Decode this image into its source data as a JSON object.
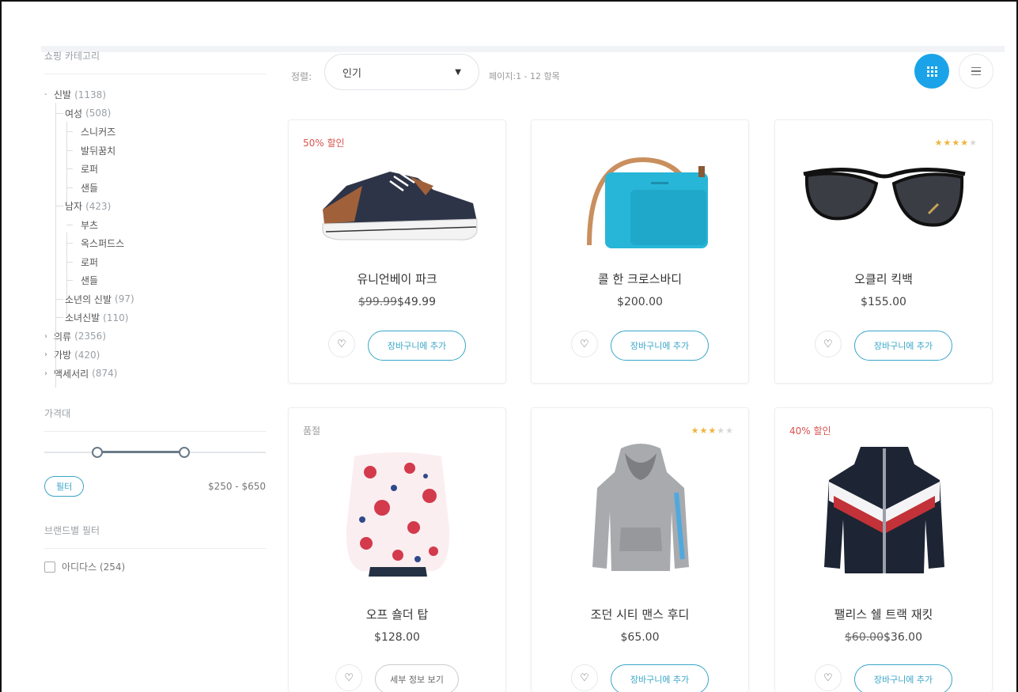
{
  "sidebar": {
    "categories_title": "쇼핑 카테고리",
    "tree": [
      {
        "label": "신발",
        "count": "(1138)",
        "caret": "-"
      },
      {
        "label": "여성",
        "count": "(508)"
      },
      {
        "label": "스니커즈"
      },
      {
        "label": "발뒤꿈치"
      },
      {
        "label": "로퍼"
      },
      {
        "label": "샌들"
      },
      {
        "label": "남자",
        "count": "(423)"
      },
      {
        "label": "부츠"
      },
      {
        "label": "옥스퍼드스"
      },
      {
        "label": "로퍼"
      },
      {
        "label": "샌들"
      },
      {
        "label": "소년의 신발",
        "count": "(97)"
      },
      {
        "label": "소녀신발",
        "count": "(110)"
      },
      {
        "label": "의류",
        "count": "(2356)",
        "caret": "›"
      },
      {
        "label": "가방",
        "count": "(420)",
        "caret": "›"
      },
      {
        "label": "액세서리",
        "count": "(874)",
        "caret": "›"
      }
    ],
    "price_title": "가격대",
    "filter_label": "필터",
    "price_range": "$250 - $650",
    "brand_title": "브랜드별 필터",
    "brand_first": "아디다스 (254)"
  },
  "toolbar": {
    "sort_label": "정렬:",
    "sort_value": "인기",
    "page_info": "페이지:1 - 12 항목"
  },
  "products": [
    {
      "badge": "50% 할인",
      "name": "유니언베이 파크",
      "old_price": "$99.99",
      "price": "$49.99",
      "button": "장바구니에 추가"
    },
    {
      "name": "콜 한 크로스바디",
      "price": "$200.00",
      "button": "장바구니에 추가"
    },
    {
      "rating": 4,
      "name": "오클리 킥백",
      "price": "$155.00",
      "button": "장바구니에 추가"
    },
    {
      "badge": "품절",
      "name": "오프 숄더 탑",
      "price": "$128.00",
      "button": "세부 정보 보기"
    },
    {
      "rating": 3,
      "name": "조던 시티 맨스 후디",
      "price": "$65.00",
      "button": "장바구니에 추가"
    },
    {
      "badge": "40% 할인",
      "name": "팰리스 쉘 트랙 재킷",
      "old_price": "$60.00",
      "price": "$36.00",
      "button": "장바구니에 추가"
    }
  ],
  "colors": {
    "accent": "#1aa3e8",
    "button_outline": "#3aa6c9",
    "sale": "#d9534f",
    "star": "#f0b43c"
  },
  "icons": {
    "grid_view": "grid-icon",
    "list_view": "list-icon",
    "wishlist": "heart-icon",
    "sort_dropdown": "caret-down-icon"
  }
}
